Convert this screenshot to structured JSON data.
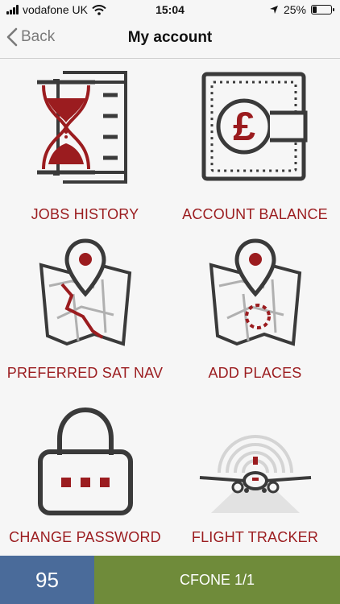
{
  "status_bar": {
    "carrier": "vodafone UK",
    "time": "15:04",
    "battery_percent": "25%",
    "battery_level": 0.25
  },
  "nav": {
    "back_label": "Back",
    "title": "My account"
  },
  "tiles": [
    {
      "label": "JOBS HISTORY",
      "icon": "hourglass-document-icon"
    },
    {
      "label": "ACCOUNT BALANCE",
      "icon": "pound-wallet-icon"
    },
    {
      "label": "PREFERRED SAT NAV",
      "icon": "map-pin-route-icon"
    },
    {
      "label": "ADD PLACES",
      "icon": "map-pin-add-icon"
    },
    {
      "label": "CHANGE PASSWORD",
      "icon": "padlock-icon"
    },
    {
      "label": "FLIGHT TRACKER",
      "icon": "airplane-radar-icon"
    }
  ],
  "bottom_bar": {
    "count": "95",
    "callsign": "CFONE 1/1"
  },
  "colors": {
    "accent_red": "#9b1c1f",
    "icon_grey": "#3a3a3a",
    "count_blue": "#4a6b9a",
    "callsign_green": "#6f8b3a"
  }
}
